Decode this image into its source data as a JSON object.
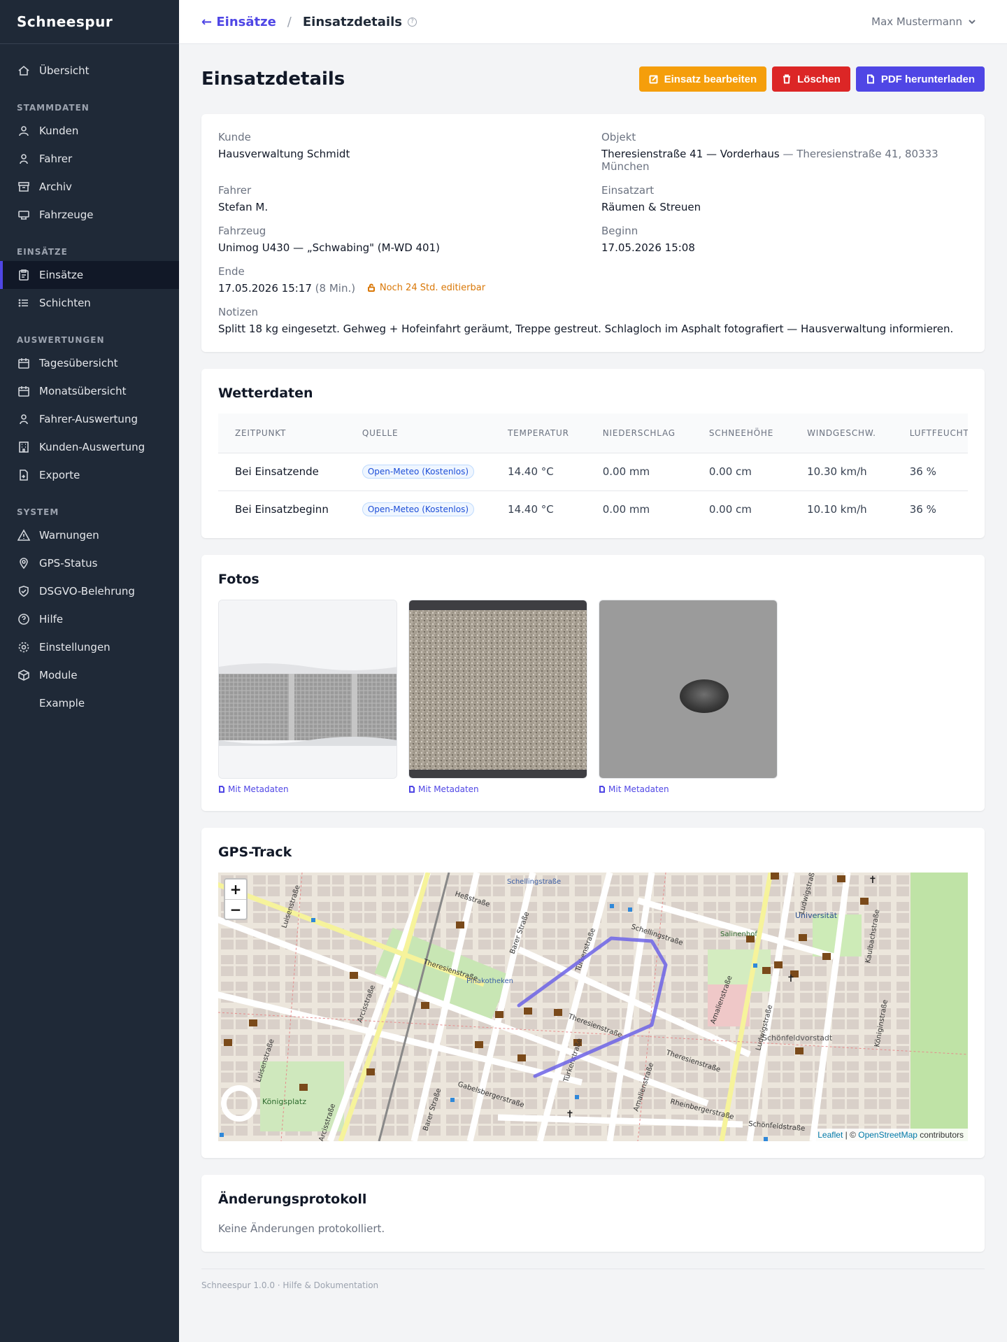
{
  "app": {
    "brand": "Schneespur"
  },
  "sidebar": {
    "top": [
      {
        "label": "Übersicht",
        "icon": "home-icon"
      }
    ],
    "sections": [
      {
        "title": "STAMMDATEN",
        "items": [
          {
            "label": "Kunden",
            "icon": "users-icon"
          },
          {
            "label": "Fahrer",
            "icon": "user-icon"
          },
          {
            "label": "Archiv",
            "icon": "archive-icon"
          },
          {
            "label": "Fahrzeuge",
            "icon": "truck-icon"
          }
        ]
      },
      {
        "title": "EINSÄTZE",
        "items": [
          {
            "label": "Einsätze",
            "icon": "clipboard-icon",
            "active": true
          },
          {
            "label": "Schichten",
            "icon": "list-icon"
          }
        ]
      },
      {
        "title": "AUSWERTUNGEN",
        "items": [
          {
            "label": "Tagesübersicht",
            "icon": "calendar-icon"
          },
          {
            "label": "Monatsübersicht",
            "icon": "calendar-month-icon"
          },
          {
            "label": "Fahrer-Auswertung",
            "icon": "user-chart-icon"
          },
          {
            "label": "Kunden-Auswertung",
            "icon": "building-icon"
          },
          {
            "label": "Exporte",
            "icon": "file-export-icon"
          }
        ]
      },
      {
        "title": "SYSTEM",
        "items": [
          {
            "label": "Warnungen",
            "icon": "warning-icon"
          },
          {
            "label": "GPS-Status",
            "icon": "map-pin-icon"
          },
          {
            "label": "DSGVO-Belehrung",
            "icon": "shield-icon"
          },
          {
            "label": "Hilfe",
            "icon": "help-icon"
          },
          {
            "label": "Einstellungen",
            "icon": "gear-icon"
          },
          {
            "label": "Module",
            "icon": "cube-icon"
          },
          {
            "label": "Example",
            "icon": ""
          }
        ]
      }
    ]
  },
  "topbar": {
    "back": "← Einsätze",
    "separator": "/",
    "current": "Einsatzdetails",
    "help": "?",
    "user": "Max Mustermann"
  },
  "page": {
    "title": "Einsatzdetails",
    "buttons": {
      "edit": "Einsatz bearbeiten",
      "delete": "Löschen",
      "pdf": "PDF herunterladen"
    }
  },
  "details": {
    "kunde": {
      "label": "Kunde",
      "value": "Hausverwaltung Schmidt"
    },
    "objekt": {
      "label": "Objekt",
      "value": "Theresienstraße 41 — Vorderhaus",
      "extra": "— Theresienstraße 41, 80333 München"
    },
    "fahrer": {
      "label": "Fahrer",
      "value": "Stefan M."
    },
    "einsatzart": {
      "label": "Einsatzart",
      "value": "Räumen & Streuen"
    },
    "fahrzeug": {
      "label": "Fahrzeug",
      "value": "Unimog U430 — „Schwabing\" (M-WD 401)"
    },
    "beginn": {
      "label": "Beginn",
      "value": "17.05.2026 15:08"
    },
    "ende": {
      "label": "Ende",
      "value": "17.05.2026 15:17",
      "duration": "(8 Min.)",
      "editable": "Noch 24 Std. editierbar"
    },
    "notizen": {
      "label": "Notizen",
      "value": "Splitt 18 kg eingesetzt. Gehweg + Hofeinfahrt geräumt, Treppe gestreut. Schlagloch im Asphalt fotografiert — Hausverwaltung informieren."
    }
  },
  "weather": {
    "title": "Wetterdaten",
    "columns": [
      "ZEITPUNKT",
      "QUELLE",
      "TEMPERATUR",
      "NIEDERSCHLAG",
      "SCHNEEHÖHE",
      "WINDGESCHW.",
      "LUFTFEUCHTIGKEIT"
    ],
    "rows": [
      [
        "Bei Einsatzende",
        "Open-Meteo (Kostenlos)",
        "14.40 °C",
        "0.00 mm",
        "0.00 cm",
        "10.30 km/h",
        "36 %"
      ],
      [
        "Bei Einsatzbeginn",
        "Open-Meteo (Kostenlos)",
        "14.40 °C",
        "0.00 mm",
        "0.00 cm",
        "10.10 km/h",
        "36 %"
      ]
    ]
  },
  "photos": {
    "title": "Fotos",
    "items": [
      {
        "link": "Mit Metadaten"
      },
      {
        "link": "Mit Metadaten"
      },
      {
        "link": "Mit Metadaten"
      }
    ]
  },
  "gps": {
    "title": "GPS-Track",
    "zoom_in": "+",
    "zoom_out": "−",
    "attribution": {
      "leaflet": "Leaflet",
      "sep": " | © ",
      "osm": "OpenStreetMap",
      "suffix": " contributors"
    },
    "track_color": "#6c63e6",
    "labels": {
      "universitaet": "Universität",
      "pinakotheken": "Pinakotheken",
      "koenigsplatz": "Königsplatz",
      "schoenfeldvorstadt": "Schönfeldvorstadt",
      "salinenhof": "Salinenhof",
      "schellingstrasse": "Schellingstraße",
      "theresienstrasse": "Theresienstraße",
      "gabelsbergerstrasse": "Gabelsbergerstraße",
      "arcisstrasse": "Arcisstraße",
      "tuerkenstrasse": "Türkenstraße",
      "ludwigstrasse": "Ludwigstraße",
      "amalienstrasse": "Amalienstraße",
      "barerstrasse": "Barer Straße",
      "luisenstrasse": "Luisenstraße",
      "heßstrasse": "Heßstraße",
      "rheinbergerstrasse": "Rheinbergerstraße",
      "koeniginstrasse": "Königinstraße",
      "kaulbachstrasse": "Kaulbachstraße",
      "schoenfeldstrasse": "Schönfeldstraße"
    }
  },
  "changelog": {
    "title": "Änderungsprotokoll",
    "empty": "Keine Änderungen protokolliert."
  },
  "footer": {
    "text": "Schneespur 1.0.0 · Hilfe & Dokumentation"
  }
}
